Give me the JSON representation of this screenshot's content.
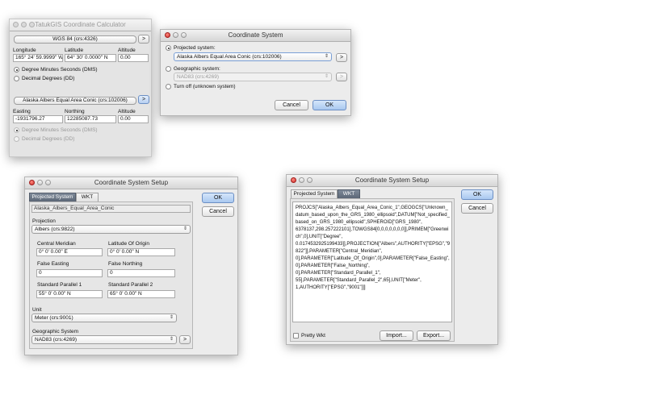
{
  "calculator": {
    "title": "TatukGIS Coordinate Calculator",
    "source_crs": "WGS 84 (crs:4326)",
    "arrow": ">",
    "labels": {
      "longitude": "Longitude",
      "latitude": "Latitude",
      "altitude": "Altitude"
    },
    "values": {
      "longitude": "165° 24' 59.9999\" W",
      "latitude": "64° 30' 0.0000\" N",
      "altitude": "0.00"
    },
    "format_dms": "Degree Minutes Seconds (DMS)",
    "format_dd": "Decimal Degrees (DD)",
    "target_crs": "Alaska Albers Equal Area Conic (crs:102006)",
    "target_labels": {
      "easting": "Easting",
      "northing": "Northing",
      "altitude": "Altitude"
    },
    "target_values": {
      "easting": "-1931796.27",
      "northing": "12285087.73",
      "altitude": "0.00"
    },
    "target_format_dms": "Degree Minutes Seconds (DMS)",
    "target_format_dd": "Decimal Degrees (DD)"
  },
  "coord_dialog": {
    "title": "Coordinate System",
    "projected_label": "Projected system:",
    "projected_value": "Alaska Albers Equal Area Conic (crs:102006)",
    "geographic_label": "Geographic system:",
    "geographic_value": "NAD83 (crs:4269)",
    "turnoff_label": "Turn off (unknown system)",
    "cancel": "Cancel",
    "ok": "OK",
    "arrow": ">"
  },
  "setup1": {
    "title": "Coordinate System Setup",
    "tabs": [
      "Projected System",
      "WKT"
    ],
    "name": "Alaska_Albers_Equal_Area_Conic",
    "projection_label": "Projection",
    "projection_value": "Albers (crs:9822)",
    "central_meridian_label": "Central Meridian",
    "central_meridian_value": "0° 0' 0.00\" E",
    "latitude_origin_label": "Latitude Of Origin",
    "latitude_origin_value": "0° 0' 0.00\" N",
    "false_easting_label": "False Easting",
    "false_easting_value": "0",
    "false_northing_label": "False Northing",
    "false_northing_value": "0",
    "std_parallel1_label": "Standard Parallel 1",
    "std_parallel1_value": "55° 0' 0.00\" N",
    "std_parallel2_label": "Standard Parallel 2",
    "std_parallel2_value": "65° 0' 0.00\" N",
    "unit_label": "Unit",
    "unit_value": "Meter (crs:9001)",
    "geo_label": "Geographic System",
    "geo_value": "NAD83 (crs:4269)",
    "ok": "OK",
    "cancel": "Cancel",
    "arrow": ">"
  },
  "setup2": {
    "title": "Coordinate System Setup",
    "tabs": [
      "Projected System",
      "WKT"
    ],
    "wkt": "PROJCS[\"Alaska_Albers_Equal_Area_Conic_1\",GEOGCS[\"Unknown_\ndatum_based_upon_the_GRS_1980_ellipsoid\",DATUM[\"Not_specified_\nbased_on_GRS_1980_ellipsoid\",SPHEROID[\"GRS_1980\",\n6378137,298.257222101],TOWGS84[0,0,0,0,0,0,0]],PRIMEM[\"Greenwi\nch\",0],UNIT[\"Degree\",\n0.0174532925199433]],PROJECTION[\"Albers\",AUTHORITY[\"EPSG\",\"9\n822\"]],PARAMETER[\"Central_Meridian\",\n0],PARAMETER[\"Latitude_Of_Origin\",0],PARAMETER[\"False_Easting\",\n0],PARAMETER[\"False_Northing\",\n0],PARAMETER[\"Standard_Parallel_1\",\n55],PARAMETER[\"Standard_Parallel_2\",65],UNIT[\"Meter\",\n1,AUTHORITY[\"EPSG\",\"9001\"]]]",
    "pretty_label": "Pretty Wkt",
    "import": "Import...",
    "export": "Export...",
    "ok": "OK",
    "cancel": "Cancel"
  }
}
